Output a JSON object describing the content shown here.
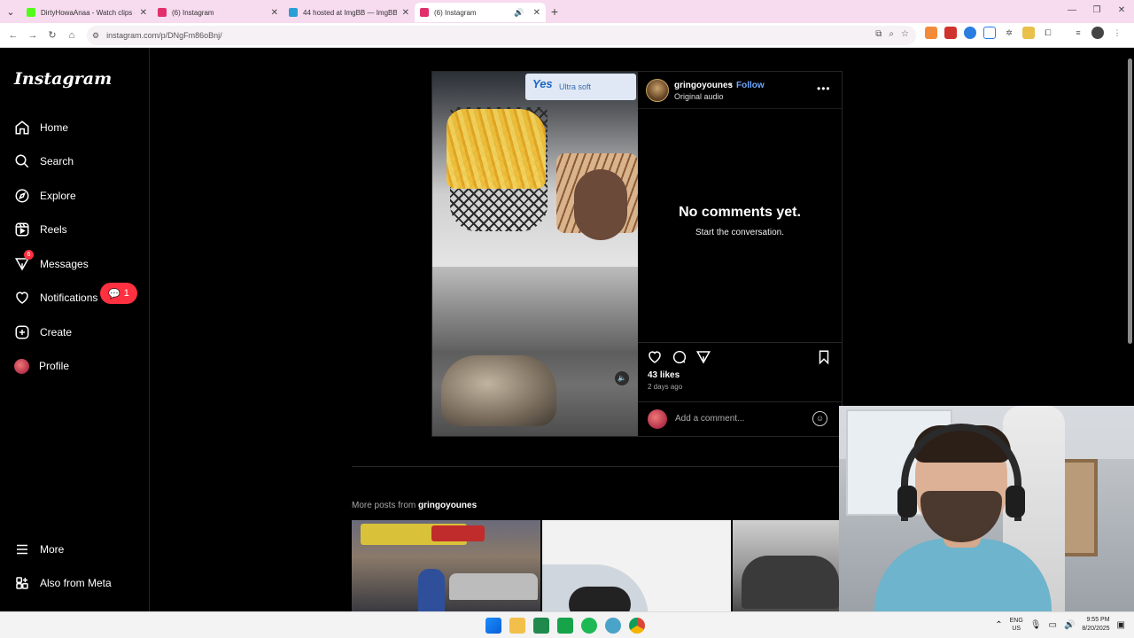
{
  "browser": {
    "tabs": [
      {
        "label": "DirtyHowaAnaa - Watch clips c",
        "favicon_color": "#53fc18",
        "active": false
      },
      {
        "label": "(6) Instagram",
        "favicon_color": "#e1306c",
        "active": false
      },
      {
        "label": "44 hosted at ImgBB — ImgBB",
        "favicon_color": "#2a9fd6",
        "active": false
      },
      {
        "label": "(6) Instagram",
        "favicon_color": "#e1306c",
        "active": true
      }
    ],
    "url": "instagram.com/p/DNgFm86oBnj/"
  },
  "sidebar": {
    "logo": "Instagram",
    "items": [
      {
        "label": "Home",
        "icon": "home-icon"
      },
      {
        "label": "Search",
        "icon": "search-icon"
      },
      {
        "label": "Explore",
        "icon": "compass-icon"
      },
      {
        "label": "Reels",
        "icon": "reels-icon"
      },
      {
        "label": "Messages",
        "icon": "messenger-icon",
        "badge": "6"
      },
      {
        "label": "Notifications",
        "icon": "heart-icon"
      },
      {
        "label": "Create",
        "icon": "plus-square-icon"
      },
      {
        "label": "Profile",
        "icon": "avatar-icon"
      },
      {
        "label": "More",
        "icon": "hamburger-icon"
      },
      {
        "label": "Also from Meta",
        "icon": "grid-icon"
      }
    ],
    "notification_bubble": "1"
  },
  "post": {
    "username": "gringoyounes",
    "separator": "•",
    "follow_label": "Follow",
    "audio": "Original audio",
    "no_comments": "No comments yet.",
    "start_conversation": "Start the conversation.",
    "likes": "43 likes",
    "date": "2 days ago",
    "comment_placeholder": "Add a comment...",
    "media_brand_text": "Yes",
    "media_brand_sub": "Ultra soft"
  },
  "more_posts": {
    "prefix": "More posts from",
    "username": "gringoyounes"
  },
  "taskbar": {
    "lang_1": "ENG",
    "lang_2": "US",
    "time": "9:55 PM",
    "date": "8/20/2025"
  },
  "colors": {
    "accent_blue": "#6ea8ff",
    "badge_red": "#ff3040",
    "tab_bar": "#f7dbef"
  }
}
